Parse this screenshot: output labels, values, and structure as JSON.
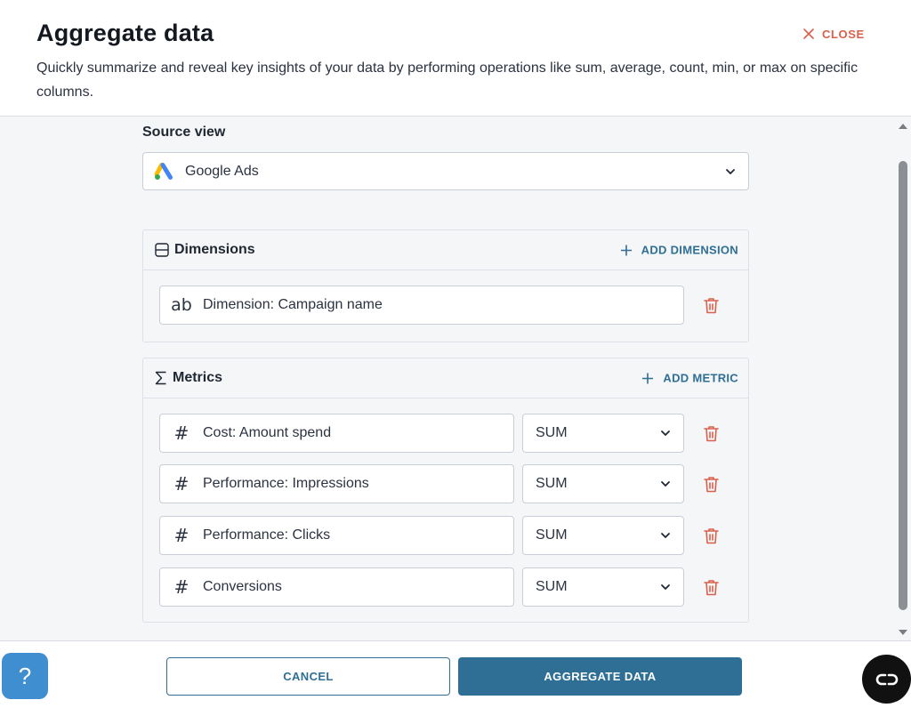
{
  "header": {
    "title": "Aggregate data",
    "subtitle": "Quickly summarize and reveal key insights of your data by performing operations like sum, average, count, min, or max on specific columns.",
    "close_label": "CLOSE"
  },
  "source": {
    "label": "Source view",
    "value": "Google Ads",
    "icon": "google-ads-icon"
  },
  "dimensions": {
    "title": "Dimensions",
    "add_label": "ADD DIMENSION",
    "items": [
      {
        "glyph": "ab",
        "label": "Dimension: Campaign name"
      }
    ]
  },
  "metrics": {
    "title": "Metrics",
    "add_label": "ADD METRIC",
    "items": [
      {
        "glyph": "#",
        "label": "Cost: Amount spend",
        "aggregation": "SUM"
      },
      {
        "glyph": "#",
        "label": "Performance: Impressions",
        "aggregation": "SUM"
      },
      {
        "glyph": "#",
        "label": "Performance: Clicks",
        "aggregation": "SUM"
      },
      {
        "glyph": "#",
        "label": "Conversions",
        "aggregation": "SUM"
      }
    ]
  },
  "footer": {
    "cancel_label": "CANCEL",
    "submit_label": "AGGREGATE DATA",
    "help_glyph": "?"
  },
  "colors": {
    "accent": "#2f6f95",
    "danger": "#d9614c",
    "help": "#3f8fd0"
  }
}
